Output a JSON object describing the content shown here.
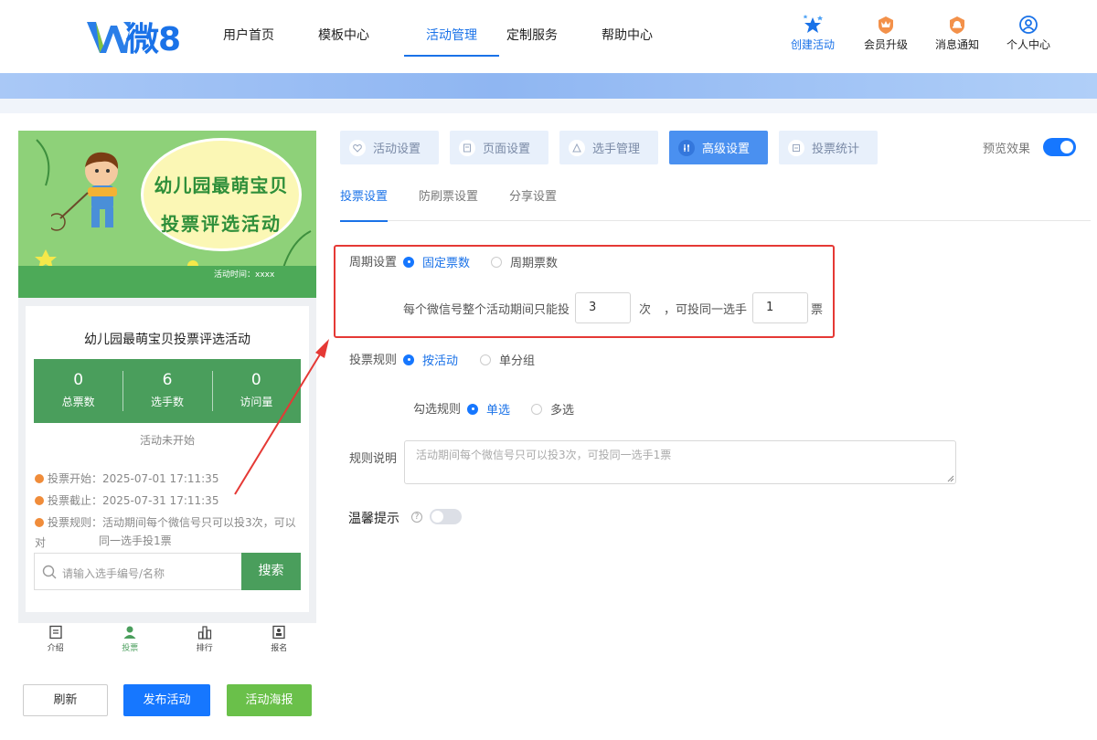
{
  "brand": {
    "logo_text": "微8"
  },
  "nav": [
    {
      "label": "用户首页"
    },
    {
      "label": "模板中心"
    },
    {
      "label": "活动管理"
    },
    {
      "label": "定制服务"
    },
    {
      "label": "帮助中心"
    }
  ],
  "top_actions": [
    {
      "label": "创建活动",
      "icon": "star-icon"
    },
    {
      "label": "会员升级",
      "icon": "crown-badge-icon"
    },
    {
      "label": "消息通知",
      "icon": "bell-badge-icon"
    },
    {
      "label": "个人中心",
      "icon": "user-icon"
    }
  ],
  "preview": {
    "poster_title_line1": "幼儿园最萌宝贝",
    "poster_title_line2": "投票评选活动",
    "poster_time": "活动时间：xxxx",
    "activity_name": "幼儿园最萌宝贝投票评选活动",
    "stats": [
      {
        "value": "0",
        "label": "总票数"
      },
      {
        "value": "6",
        "label": "选手数"
      },
      {
        "value": "0",
        "label": "访问量"
      }
    ],
    "status": "活动未开始",
    "vote_start": "投票开始：2025-07-01 17:11:35",
    "vote_end": "投票截止：2025-07-31 17:11:35",
    "vote_rule_line1": "投票规则：活动期间每个微信号只可以投3次，可以对",
    "vote_rule_line2": "同一选手投1票",
    "search_placeholder": "请输入选手编号/名称",
    "search_button": "搜索",
    "tabbar": [
      {
        "label": "介绍",
        "icon": "intro-icon"
      },
      {
        "label": "投票",
        "icon": "vote-person-icon"
      },
      {
        "label": "排行",
        "icon": "ranking-icon"
      },
      {
        "label": "报名",
        "icon": "signup-icon"
      }
    ]
  },
  "bottom_buttons": {
    "refresh": "刷新",
    "publish": "发布活动",
    "poster": "活动海报"
  },
  "step_tabs": [
    {
      "label": "活动设置",
      "icon": "heart-icon"
    },
    {
      "label": "页面设置",
      "icon": "page-icon"
    },
    {
      "label": "选手管理",
      "icon": "player-icon"
    },
    {
      "label": "高级设置",
      "icon": "sliders-icon"
    },
    {
      "label": "投票统计",
      "icon": "stats-icon"
    }
  ],
  "preview_toggle_label": "预览效果",
  "sub_tabs": [
    {
      "label": "投票设置"
    },
    {
      "label": "防刷票设置"
    },
    {
      "label": "分享设置"
    }
  ],
  "form": {
    "period_label": "周期设置",
    "period_options": [
      "固定票数",
      "周期票数"
    ],
    "limit_prefix": "每个微信号整个活动期间只能投",
    "limit_votes": "3",
    "limit_mid1": "次",
    "limit_mid2": "，可投同一选手",
    "same_player_votes": "1",
    "limit_suffix": "票",
    "rule_label": "投票规则",
    "rule_options": [
      "按活动",
      "单分组"
    ],
    "select_rule_label": "勾选规则",
    "select_options": [
      "单选",
      "多选"
    ],
    "desc_label": "规则说明",
    "desc_placeholder": "活动期间每个微信号只可以投3次，可投同一选手1票",
    "warm_tip_label": "温馨提示",
    "help_glyph": "?"
  },
  "colors": {
    "primary": "#1677ff",
    "green": "#4a9e5c",
    "highlight_border": "#e53935"
  }
}
